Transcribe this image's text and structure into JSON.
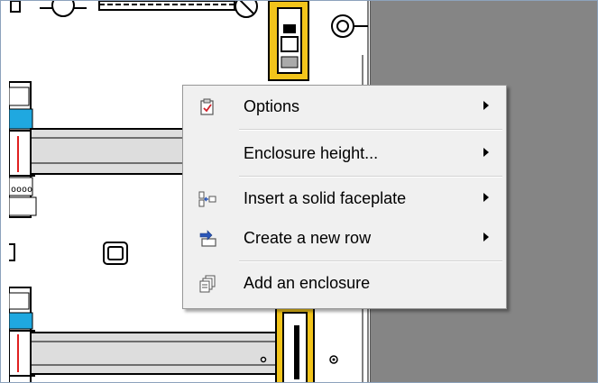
{
  "context_menu": {
    "items": [
      {
        "label": "Options",
        "icon": "checklist-icon",
        "submenu": true
      },
      {
        "label": "Enclosure height...",
        "icon": "",
        "submenu": true
      },
      {
        "label": "Insert a solid faceplate",
        "icon": "faceplate-icon",
        "submenu": true
      },
      {
        "label": "Create a new row",
        "icon": "new-row-icon",
        "submenu": true
      },
      {
        "label": "Add an enclosure",
        "icon": "enclosure-icon",
        "submenu": false
      }
    ]
  },
  "colors": {
    "menu_background": "#f0f0f0",
    "grey_workspace": "#858585",
    "breaker_yellow": "#f2c41b",
    "rail_fill": "#dddddd"
  }
}
